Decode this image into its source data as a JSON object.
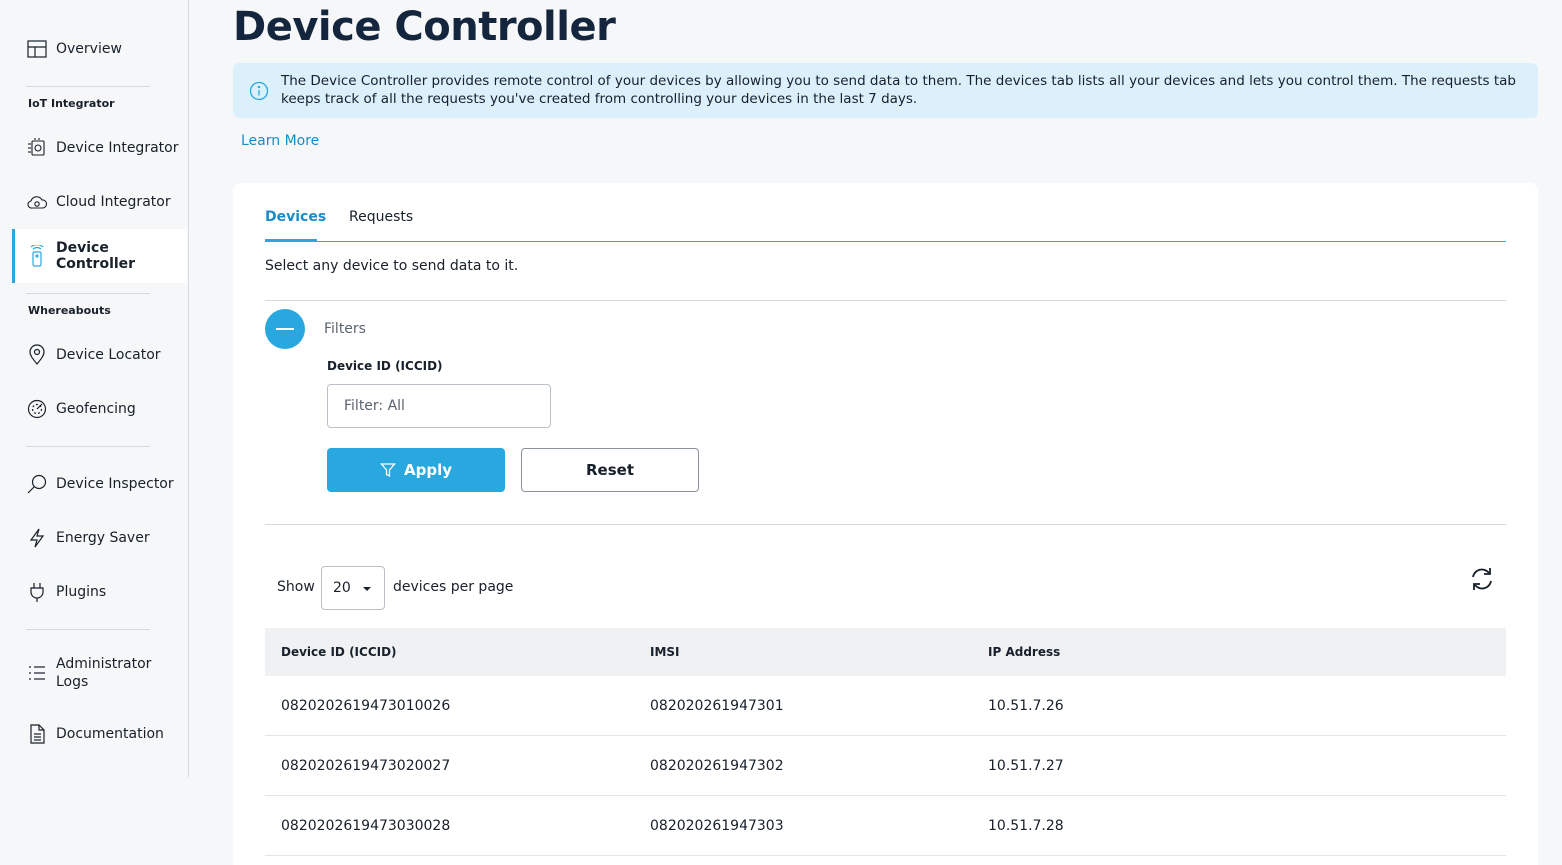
{
  "sidebar": {
    "overview": "Overview",
    "section_iot": "IoT Integrator",
    "device_integrator": "Device Integrator",
    "cloud_integrator": "Cloud Integrator",
    "device_controller": "Device Controller",
    "section_whereabouts": "Whereabouts",
    "device_locator": "Device Locator",
    "geofencing": "Geofencing",
    "device_inspector": "Device Inspector",
    "energy_saver": "Energy Saver",
    "plugins": "Plugins",
    "admin_logs": "Administrator Logs",
    "documentation": "Documentation"
  },
  "main": {
    "title": "Device Controller",
    "info": "The Device Controller provides remote control of your devices by allowing you to send data to them. The devices tab lists all your devices and lets you control them. The requests tab keeps track of all the requests you've created from controlling your devices in the last 7 days.",
    "learn_more": "Learn More",
    "tabs": [
      "Devices",
      "Requests"
    ],
    "hint": "Select any device to send data to it.",
    "filters": {
      "label": "Filters",
      "field_label": "Device ID (ICCID)",
      "placeholder": "Filter: All",
      "apply": "Apply",
      "reset": "Reset"
    },
    "pagination": {
      "show": "Show",
      "per_page_value": "20",
      "per_page_suffix": "devices per page"
    },
    "table": {
      "headers": [
        "Device ID (ICCID)",
        "IMSI",
        "IP Address"
      ],
      "rows": [
        [
          "0820202619473010026",
          "082020261947301",
          "10.51.7.26"
        ],
        [
          "0820202619473020027",
          "082020261947302",
          "10.51.7.27"
        ],
        [
          "0820202619473030028",
          "082020261947303",
          "10.51.7.28"
        ]
      ]
    }
  },
  "colors": {
    "accent": "#29a8e0",
    "banner_bg": "#dcf0fb",
    "title": "#14263e"
  }
}
